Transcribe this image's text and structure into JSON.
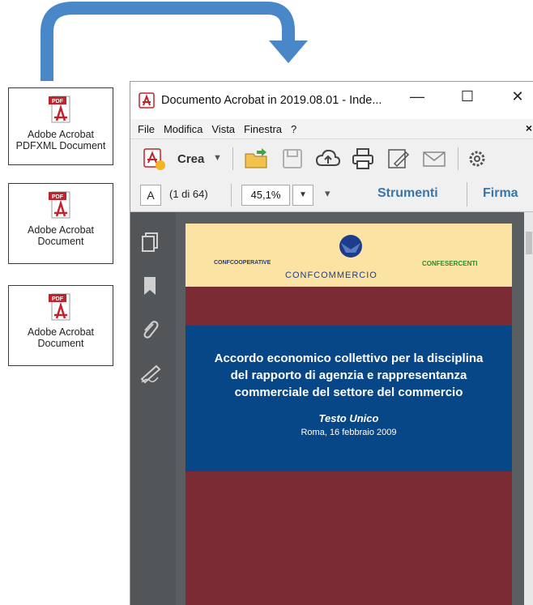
{
  "file_icons": [
    {
      "label": "Adobe Acrobat\nPDFXML Document",
      "badge": "PDF"
    },
    {
      "label": "Adobe Acrobat\nDocument",
      "badge": "PDF"
    },
    {
      "label": "Adobe Acrobat\nDocument",
      "badge": "PDF"
    }
  ],
  "window": {
    "title": "Documento Acrobat in 2019.08.01 - Inde...",
    "controls": {
      "minimize": "—",
      "maximize": "☐",
      "close": "✕"
    }
  },
  "menu": {
    "items": [
      "File",
      "Modifica",
      "Vista",
      "Finestra",
      "?"
    ],
    "close_doc": "×"
  },
  "toolbar": {
    "create_label": "Crea",
    "icons": [
      "open-folder-icon",
      "save-icon",
      "cloud-upload-icon",
      "print-icon",
      "edit-icon",
      "email-icon",
      "settings-icon"
    ]
  },
  "nav": {
    "select_text_button": "A",
    "page_info": "(1 di 64)",
    "zoom": "45,1%",
    "tools_tab": "Strumenti",
    "sign_tab": "Firma"
  },
  "document": {
    "logos": [
      "CONFCOOPERATIVE",
      "CONFCOMMERCIO",
      "CONFESERCENTI"
    ],
    "title": "Accordo economico collettivo per la disciplina del rapporto di agenzia e rappresentanza commerciale del settore del commercio",
    "subtitle": "Testo Unico",
    "date": "Roma, 16 febbraio 2009"
  },
  "colors": {
    "arrow": "#4a87c8",
    "page_header": "#fbe3a4",
    "page_body": "#7b2b33",
    "title_band": "#084787",
    "tab_text": "#3a76a8"
  }
}
